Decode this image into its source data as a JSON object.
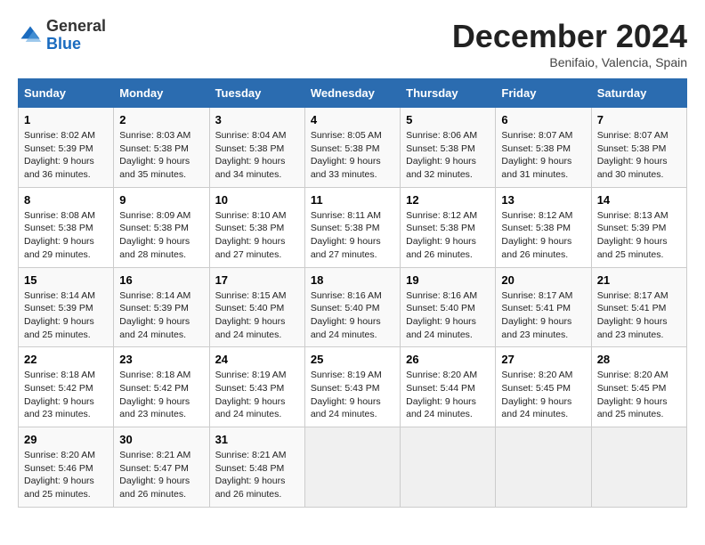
{
  "header": {
    "logo_line1": "General",
    "logo_line2": "Blue",
    "month": "December 2024",
    "location": "Benifaio, Valencia, Spain"
  },
  "weekdays": [
    "Sunday",
    "Monday",
    "Tuesday",
    "Wednesday",
    "Thursday",
    "Friday",
    "Saturday"
  ],
  "weeks": [
    [
      {
        "day": "1",
        "sunrise": "8:02 AM",
        "sunset": "5:39 PM",
        "daylight": "9 hours and 36 minutes."
      },
      {
        "day": "2",
        "sunrise": "8:03 AM",
        "sunset": "5:38 PM",
        "daylight": "9 hours and 35 minutes."
      },
      {
        "day": "3",
        "sunrise": "8:04 AM",
        "sunset": "5:38 PM",
        "daylight": "9 hours and 34 minutes."
      },
      {
        "day": "4",
        "sunrise": "8:05 AM",
        "sunset": "5:38 PM",
        "daylight": "9 hours and 33 minutes."
      },
      {
        "day": "5",
        "sunrise": "8:06 AM",
        "sunset": "5:38 PM",
        "daylight": "9 hours and 32 minutes."
      },
      {
        "day": "6",
        "sunrise": "8:07 AM",
        "sunset": "5:38 PM",
        "daylight": "9 hours and 31 minutes."
      },
      {
        "day": "7",
        "sunrise": "8:07 AM",
        "sunset": "5:38 PM",
        "daylight": "9 hours and 30 minutes."
      }
    ],
    [
      {
        "day": "8",
        "sunrise": "8:08 AM",
        "sunset": "5:38 PM",
        "daylight": "9 hours and 29 minutes."
      },
      {
        "day": "9",
        "sunrise": "8:09 AM",
        "sunset": "5:38 PM",
        "daylight": "9 hours and 28 minutes."
      },
      {
        "day": "10",
        "sunrise": "8:10 AM",
        "sunset": "5:38 PM",
        "daylight": "9 hours and 27 minutes."
      },
      {
        "day": "11",
        "sunrise": "8:11 AM",
        "sunset": "5:38 PM",
        "daylight": "9 hours and 27 minutes."
      },
      {
        "day": "12",
        "sunrise": "8:12 AM",
        "sunset": "5:38 PM",
        "daylight": "9 hours and 26 minutes."
      },
      {
        "day": "13",
        "sunrise": "8:12 AM",
        "sunset": "5:38 PM",
        "daylight": "9 hours and 26 minutes."
      },
      {
        "day": "14",
        "sunrise": "8:13 AM",
        "sunset": "5:39 PM",
        "daylight": "9 hours and 25 minutes."
      }
    ],
    [
      {
        "day": "15",
        "sunrise": "8:14 AM",
        "sunset": "5:39 PM",
        "daylight": "9 hours and 25 minutes."
      },
      {
        "day": "16",
        "sunrise": "8:14 AM",
        "sunset": "5:39 PM",
        "daylight": "9 hours and 24 minutes."
      },
      {
        "day": "17",
        "sunrise": "8:15 AM",
        "sunset": "5:40 PM",
        "daylight": "9 hours and 24 minutes."
      },
      {
        "day": "18",
        "sunrise": "8:16 AM",
        "sunset": "5:40 PM",
        "daylight": "9 hours and 24 minutes."
      },
      {
        "day": "19",
        "sunrise": "8:16 AM",
        "sunset": "5:40 PM",
        "daylight": "9 hours and 24 minutes."
      },
      {
        "day": "20",
        "sunrise": "8:17 AM",
        "sunset": "5:41 PM",
        "daylight": "9 hours and 23 minutes."
      },
      {
        "day": "21",
        "sunrise": "8:17 AM",
        "sunset": "5:41 PM",
        "daylight": "9 hours and 23 minutes."
      }
    ],
    [
      {
        "day": "22",
        "sunrise": "8:18 AM",
        "sunset": "5:42 PM",
        "daylight": "9 hours and 23 minutes."
      },
      {
        "day": "23",
        "sunrise": "8:18 AM",
        "sunset": "5:42 PM",
        "daylight": "9 hours and 23 minutes."
      },
      {
        "day": "24",
        "sunrise": "8:19 AM",
        "sunset": "5:43 PM",
        "daylight": "9 hours and 24 minutes."
      },
      {
        "day": "25",
        "sunrise": "8:19 AM",
        "sunset": "5:43 PM",
        "daylight": "9 hours and 24 minutes."
      },
      {
        "day": "26",
        "sunrise": "8:20 AM",
        "sunset": "5:44 PM",
        "daylight": "9 hours and 24 minutes."
      },
      {
        "day": "27",
        "sunrise": "8:20 AM",
        "sunset": "5:45 PM",
        "daylight": "9 hours and 24 minutes."
      },
      {
        "day": "28",
        "sunrise": "8:20 AM",
        "sunset": "5:45 PM",
        "daylight": "9 hours and 25 minutes."
      }
    ],
    [
      {
        "day": "29",
        "sunrise": "8:20 AM",
        "sunset": "5:46 PM",
        "daylight": "9 hours and 25 minutes."
      },
      {
        "day": "30",
        "sunrise": "8:21 AM",
        "sunset": "5:47 PM",
        "daylight": "9 hours and 26 minutes."
      },
      {
        "day": "31",
        "sunrise": "8:21 AM",
        "sunset": "5:48 PM",
        "daylight": "9 hours and 26 minutes."
      },
      null,
      null,
      null,
      null
    ]
  ]
}
